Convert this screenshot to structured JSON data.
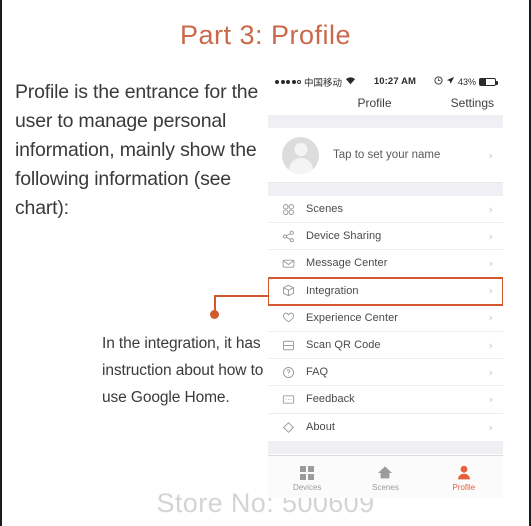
{
  "slide": {
    "title": "Part 3: Profile",
    "title_color": "#c96a4a",
    "paragraph_1": "Profile is the entrance for the user to manage personal information, mainly show the following information (see chart):",
    "paragraph_2": "In the integration, it has instruction about how to use Google Home.",
    "watermark": "Store No: 500609",
    "accent_color": "#d2582e"
  },
  "phone": {
    "status_bar": {
      "carrier": "中国移动",
      "signal_icon": "signal-dots-icon",
      "wifi_icon": "wifi-icon",
      "time": "10:27 AM",
      "alarm_icon": "alarm-icon",
      "location_icon": "location-arrow-icon",
      "battery_percent": "43%",
      "battery_icon": "battery-icon"
    },
    "nav": {
      "title": "Profile",
      "settings_label": "Settings"
    },
    "account": {
      "avatar_icon": "avatar-placeholder-icon",
      "label": "Tap to set your name",
      "chevron": "›"
    },
    "menu": [
      {
        "label": "Scenes",
        "icon": "scenes-grid-icon",
        "chevron": "›",
        "highlighted": false
      },
      {
        "label": "Device Sharing",
        "icon": "share-icon",
        "chevron": "›",
        "highlighted": false
      },
      {
        "label": "Message Center",
        "icon": "envelope-icon",
        "chevron": "›",
        "highlighted": false
      },
      {
        "label": "Integration",
        "icon": "cube-icon",
        "chevron": "›",
        "highlighted": true
      },
      {
        "label": "Experience Center",
        "icon": "heart-icon",
        "chevron": "›",
        "highlighted": false
      },
      {
        "label": "Scan QR Code",
        "icon": "scan-icon",
        "chevron": "›",
        "highlighted": false
      },
      {
        "label": "FAQ",
        "icon": "question-mark-icon",
        "chevron": "›",
        "highlighted": false
      },
      {
        "label": "Feedback",
        "icon": "feedback-icon",
        "chevron": "›",
        "highlighted": false
      },
      {
        "label": "About",
        "icon": "diamond-icon",
        "chevron": "›",
        "highlighted": false
      }
    ],
    "tabs": [
      {
        "label": "Devices",
        "icon": "grid-icon",
        "active": false
      },
      {
        "label": "Scenes",
        "icon": "home-icon",
        "active": false
      },
      {
        "label": "Profile",
        "icon": "person-icon",
        "active": true
      }
    ]
  }
}
